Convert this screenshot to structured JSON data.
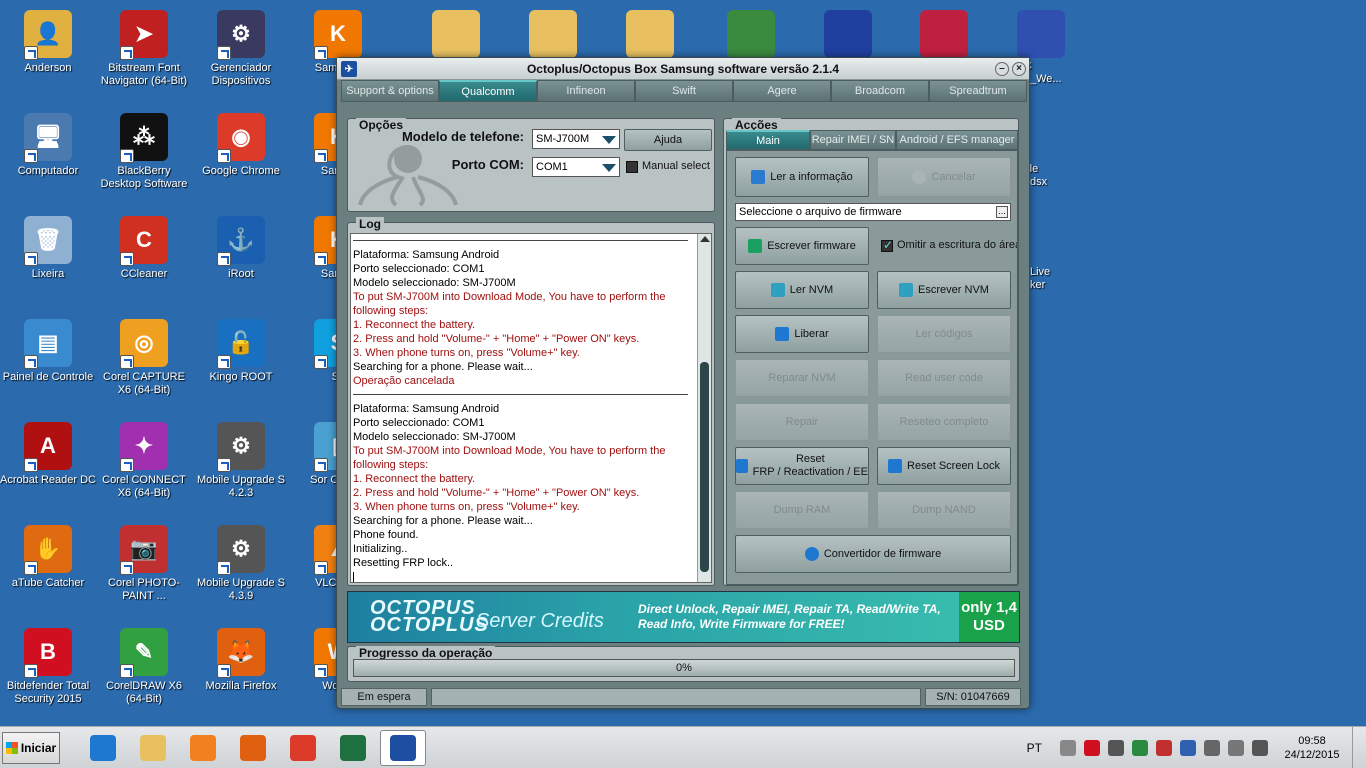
{
  "desktop_icons": [
    {
      "label": "Anderson",
      "color": "#e0b040",
      "glyph": "👤"
    },
    {
      "label": "Bitstream Font Navigator (64-Bit)",
      "color": "#c02020",
      "glyph": "➤"
    },
    {
      "label": "Gerenciador Dispositivos",
      "color": "#3a3a60",
      "glyph": "⚙"
    },
    {
      "label": "Samsung",
      "color": "#f07800",
      "glyph": "K"
    },
    {
      "label": "Computador",
      "color": "#4a7ab0",
      "glyph": "🖥"
    },
    {
      "label": "BlackBerry Desktop Software",
      "color": "#111111",
      "glyph": "⁂"
    },
    {
      "label": "Google Chrome",
      "color": "#dd3b2a",
      "glyph": "◉"
    },
    {
      "label": "Samsu",
      "color": "#f07800",
      "glyph": "K"
    },
    {
      "label": "Lixeira",
      "color": "#8fb0d0",
      "glyph": "🗑"
    },
    {
      "label": "CCleaner",
      "color": "#d03020",
      "glyph": "C"
    },
    {
      "label": "iRoot",
      "color": "#1a5fb0",
      "glyph": "⚓"
    },
    {
      "label": "Samsu",
      "color": "#f07800",
      "glyph": "K"
    },
    {
      "label": "Painel de Controle",
      "color": "#3a8ad0",
      "glyph": "▤"
    },
    {
      "label": "Corel CAPTURE X6 (64-Bit)",
      "color": "#f0a020",
      "glyph": "◎"
    },
    {
      "label": "Kingo ROOT",
      "color": "#1a70c0",
      "glyph": "🔓"
    },
    {
      "label": "Sk",
      "color": "#10a0e0",
      "glyph": "S"
    },
    {
      "label": "Acrobat Reader DC",
      "color": "#b01010",
      "glyph": "A"
    },
    {
      "label": "Corel CONNECT X6 (64-Bit)",
      "color": "#a030b0",
      "glyph": "✦"
    },
    {
      "label": "Mobile Upgrade S 4.2.3",
      "color": "#555555",
      "glyph": "⚙"
    },
    {
      "label": "Sor Compa",
      "color": "#4aa0d0",
      "glyph": "▯"
    },
    {
      "label": "aTube Catcher",
      "color": "#e06a10",
      "glyph": "✋"
    },
    {
      "label": "Corel PHOTO-PAINT ...",
      "color": "#c03030",
      "glyph": "📷"
    },
    {
      "label": "Mobile Upgrade S 4.3.9",
      "color": "#555555",
      "glyph": "⚙"
    },
    {
      "label": "VLC med",
      "color": "#f08010",
      "glyph": "▲"
    },
    {
      "label": "Bitdefender Total Security 2015",
      "color": "#d01020",
      "glyph": "B"
    },
    {
      "label": "CorelDRAW X6 (64-Bit)",
      "color": "#30a040",
      "glyph": "✎"
    },
    {
      "label": "Mozilla Firefox",
      "color": "#e06010",
      "glyph": "🦊"
    },
    {
      "label": "Workb",
      "color": "#f07800",
      "glyph": "W"
    }
  ],
  "top_icons": [
    {
      "label": "",
      "color": "#e8c060"
    },
    {
      "label": "",
      "color": "#e8c060"
    },
    {
      "label": "",
      "color": "#e8c060"
    },
    {
      "label": "",
      "color": "#3a8a40"
    },
    {
      "label": "",
      "color": "#2040a0"
    },
    {
      "label": "",
      "color": "#c02040"
    },
    {
      "label": "",
      "color": "#3050b0"
    }
  ],
  "right_edge_labels": [
    "C",
    "_We...",
    "de",
    "dsx",
    "Live",
    "ker"
  ],
  "window": {
    "title": "Octoplus/Octopus Box Samsung software versão 2.1.4",
    "tabs": [
      "Support & options",
      "Qualcomm",
      "Infineon",
      "Swift",
      "Agere",
      "Broadcom",
      "Spreadtrum"
    ],
    "active_tab": 1,
    "opcoes": {
      "title": "Opções",
      "model_label": "Modelo de telefone:",
      "model_value": "SM-J700M",
      "help_label": "Ajuda",
      "port_label": "Porto COM:",
      "port_value": "COM1",
      "manual_select_label": "Manual select"
    },
    "log": {
      "title": "Log",
      "lines": [
        {
          "t": "sep"
        },
        {
          "t": "n",
          "text": "Plataforma: Samsung Android"
        },
        {
          "t": "n",
          "text": "Porto seleccionado: COM1"
        },
        {
          "t": "n",
          "text": "Modelo seleccionado: SM-J700M"
        },
        {
          "t": "r",
          "text": "To put SM-J700M into Download Mode, You have to perform the"
        },
        {
          "t": "r",
          "text": " following steps:"
        },
        {
          "t": "r",
          "text": "1. Reconnect the battery."
        },
        {
          "t": "r",
          "text": "2. Press and hold \"Volume-\" + \"Home\" + \"Power ON\" keys."
        },
        {
          "t": "r",
          "text": "3. When phone turns on, press \"Volume+\" key."
        },
        {
          "t": "n",
          "text": "Searching for a phone. Please wait..."
        },
        {
          "t": "r",
          "text": "Operação cancelada"
        },
        {
          "t": "sep"
        },
        {
          "t": "n",
          "text": "Plataforma: Samsung Android"
        },
        {
          "t": "n",
          "text": "Porto seleccionado: COM1"
        },
        {
          "t": "n",
          "text": "Modelo seleccionado: SM-J700M"
        },
        {
          "t": "r",
          "text": "To put SM-J700M into Download Mode, You have to perform the"
        },
        {
          "t": "r",
          "text": " following steps:"
        },
        {
          "t": "r",
          "text": "1. Reconnect the battery."
        },
        {
          "t": "r",
          "text": "2. Press and hold \"Volume-\" + \"Home\" + \"Power ON\" keys."
        },
        {
          "t": "r",
          "text": "3. When phone turns on, press \"Volume+\" key."
        },
        {
          "t": "n",
          "text": "Searching for a phone. Please wait..."
        },
        {
          "t": "n",
          "text": "Phone found."
        },
        {
          "t": "n",
          "text": "Initializing.."
        },
        {
          "t": "n",
          "text": "Resetting FRP lock.."
        }
      ]
    },
    "accoes": {
      "title": "Acções",
      "subtabs": [
        "Main",
        "Repair IMEI / SN",
        "Android / EFS manager"
      ],
      "read_info": "Ler a informação",
      "cancel": "Cancelar",
      "fw_placeholder": "Seleccione o arquivo de firmware",
      "fw_dots": "...",
      "write_fw": "Escrever firmware",
      "skip_area": "Omitir a escritura do área",
      "read_nvm": "Ler NVM",
      "write_nvm": "Escrever NVM",
      "unlock": "Liberar",
      "read_codes": "Ler códigos",
      "repair_nvm": "Reparar NVM",
      "read_user_code": "Read user code",
      "repair": "Repair",
      "full_reset": "Reseteo completo",
      "reset_frp_1": "Reset",
      "reset_frp_2": "FRP / Reactivation / EE",
      "reset_screen_lock": "Reset Screen Lock",
      "dump_ram": "Dump RAM",
      "dump_nand": "Dump NAND",
      "fw_converter": "Convertidor de firmware"
    },
    "banner": {
      "logo_top": "OCTOPUS",
      "logo_bottom": "OCTOPLUS",
      "server_credits": "Server Credits",
      "line1": "Direct Unlock, Repair IMEI, Repair TA, Read/Write TA,",
      "line2": "Read Info, Write Firmware for FREE!",
      "price_1": "only 1,4",
      "price_2": "USD"
    },
    "progress": {
      "title": "Progresso da operação",
      "value_text": "0%",
      "value": 0
    },
    "status": {
      "left": "Em espera",
      "serial": "S/N: 01047669"
    }
  },
  "taskbar": {
    "start": "Iniciar",
    "apps": [
      {
        "name": "ie",
        "color": "#1e78d0"
      },
      {
        "name": "explorer",
        "color": "#e8c060"
      },
      {
        "name": "media",
        "color": "#f08020"
      },
      {
        "name": "firefox",
        "color": "#e06010"
      },
      {
        "name": "chrome",
        "color": "#dd3b2a"
      },
      {
        "name": "excel",
        "color": "#1e7040"
      },
      {
        "name": "octoplus",
        "color": "#1d4fa0"
      }
    ],
    "lang": "PT",
    "time": "09:58",
    "date": "24/12/2015"
  }
}
